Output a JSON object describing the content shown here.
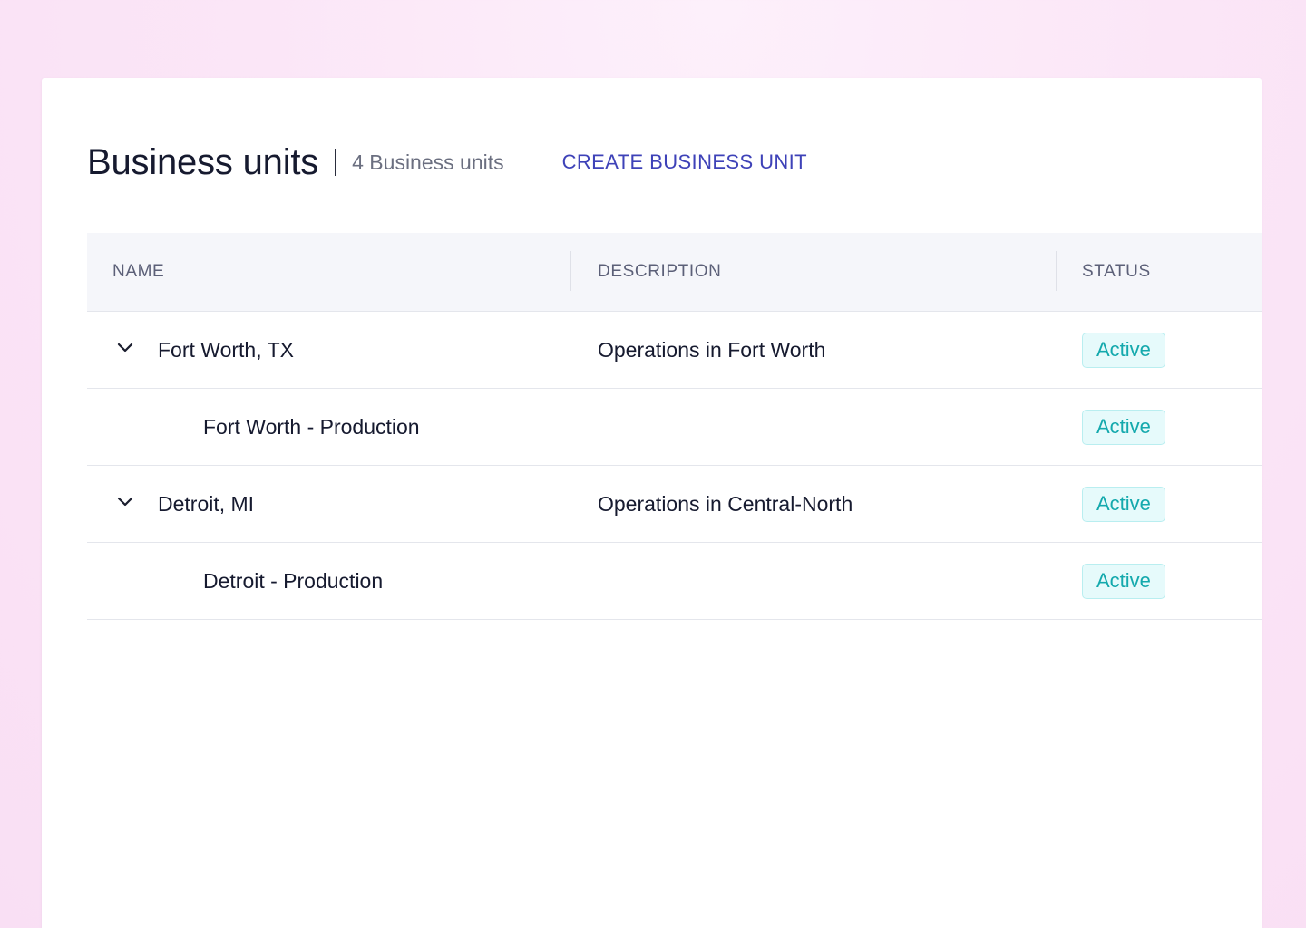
{
  "header": {
    "title": "Business units",
    "count_label": "4 Business units",
    "create_label": "CREATE BUSINESS UNIT"
  },
  "table": {
    "columns": {
      "name": "NAME",
      "description": "DESCRIPTION",
      "status": "STATUS"
    },
    "rows": [
      {
        "name": "Fort Worth, TX",
        "description": "Operations in Fort Worth",
        "status": "Active",
        "level": "parent",
        "expanded": true
      },
      {
        "name": "Fort Worth - Production",
        "description": "",
        "status": "Active",
        "level": "child"
      },
      {
        "name": "Detroit, MI",
        "description": "Operations in Central-North",
        "status": "Active",
        "level": "parent",
        "expanded": true
      },
      {
        "name": "Detroit - Production",
        "description": "",
        "status": "Active",
        "level": "child"
      }
    ]
  },
  "colors": {
    "accent": "#3e42b8",
    "status_active_text": "#14a9ad",
    "status_active_bg": "#e6fafb",
    "header_bg": "#f5f6fa"
  },
  "icons": {
    "expand": "chevron-down-icon"
  }
}
